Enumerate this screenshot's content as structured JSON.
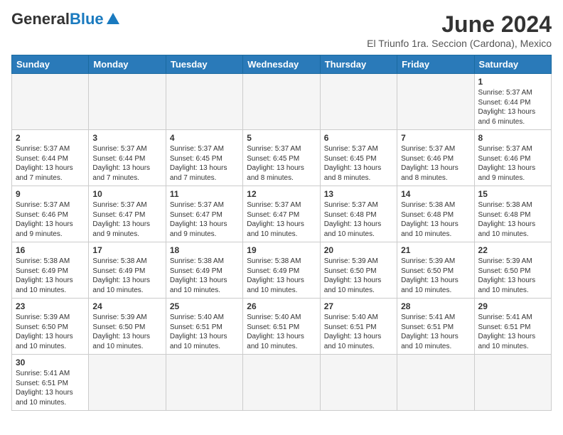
{
  "header": {
    "logo_general": "General",
    "logo_blue": "Blue",
    "title": "June 2024",
    "subtitle": "El Triunfo 1ra. Seccion (Cardona), Mexico"
  },
  "days_of_week": [
    "Sunday",
    "Monday",
    "Tuesday",
    "Wednesday",
    "Thursday",
    "Friday",
    "Saturday"
  ],
  "weeks": [
    [
      {
        "day": "",
        "info": ""
      },
      {
        "day": "",
        "info": ""
      },
      {
        "day": "",
        "info": ""
      },
      {
        "day": "",
        "info": ""
      },
      {
        "day": "",
        "info": ""
      },
      {
        "day": "",
        "info": ""
      },
      {
        "day": "1",
        "info": "Sunrise: 5:37 AM\nSunset: 6:44 PM\nDaylight: 13 hours and 6 minutes."
      }
    ],
    [
      {
        "day": "2",
        "info": "Sunrise: 5:37 AM\nSunset: 6:44 PM\nDaylight: 13 hours and 7 minutes."
      },
      {
        "day": "3",
        "info": "Sunrise: 5:37 AM\nSunset: 6:44 PM\nDaylight: 13 hours and 7 minutes."
      },
      {
        "day": "4",
        "info": "Sunrise: 5:37 AM\nSunset: 6:45 PM\nDaylight: 13 hours and 7 minutes."
      },
      {
        "day": "5",
        "info": "Sunrise: 5:37 AM\nSunset: 6:45 PM\nDaylight: 13 hours and 8 minutes."
      },
      {
        "day": "6",
        "info": "Sunrise: 5:37 AM\nSunset: 6:45 PM\nDaylight: 13 hours and 8 minutes."
      },
      {
        "day": "7",
        "info": "Sunrise: 5:37 AM\nSunset: 6:46 PM\nDaylight: 13 hours and 8 minutes."
      },
      {
        "day": "8",
        "info": "Sunrise: 5:37 AM\nSunset: 6:46 PM\nDaylight: 13 hours and 9 minutes."
      }
    ],
    [
      {
        "day": "9",
        "info": "Sunrise: 5:37 AM\nSunset: 6:46 PM\nDaylight: 13 hours and 9 minutes."
      },
      {
        "day": "10",
        "info": "Sunrise: 5:37 AM\nSunset: 6:47 PM\nDaylight: 13 hours and 9 minutes."
      },
      {
        "day": "11",
        "info": "Sunrise: 5:37 AM\nSunset: 6:47 PM\nDaylight: 13 hours and 9 minutes."
      },
      {
        "day": "12",
        "info": "Sunrise: 5:37 AM\nSunset: 6:47 PM\nDaylight: 13 hours and 10 minutes."
      },
      {
        "day": "13",
        "info": "Sunrise: 5:37 AM\nSunset: 6:48 PM\nDaylight: 13 hours and 10 minutes."
      },
      {
        "day": "14",
        "info": "Sunrise: 5:38 AM\nSunset: 6:48 PM\nDaylight: 13 hours and 10 minutes."
      },
      {
        "day": "15",
        "info": "Sunrise: 5:38 AM\nSunset: 6:48 PM\nDaylight: 13 hours and 10 minutes."
      }
    ],
    [
      {
        "day": "16",
        "info": "Sunrise: 5:38 AM\nSunset: 6:49 PM\nDaylight: 13 hours and 10 minutes."
      },
      {
        "day": "17",
        "info": "Sunrise: 5:38 AM\nSunset: 6:49 PM\nDaylight: 13 hours and 10 minutes."
      },
      {
        "day": "18",
        "info": "Sunrise: 5:38 AM\nSunset: 6:49 PM\nDaylight: 13 hours and 10 minutes."
      },
      {
        "day": "19",
        "info": "Sunrise: 5:38 AM\nSunset: 6:49 PM\nDaylight: 13 hours and 10 minutes."
      },
      {
        "day": "20",
        "info": "Sunrise: 5:39 AM\nSunset: 6:50 PM\nDaylight: 13 hours and 10 minutes."
      },
      {
        "day": "21",
        "info": "Sunrise: 5:39 AM\nSunset: 6:50 PM\nDaylight: 13 hours and 10 minutes."
      },
      {
        "day": "22",
        "info": "Sunrise: 5:39 AM\nSunset: 6:50 PM\nDaylight: 13 hours and 10 minutes."
      }
    ],
    [
      {
        "day": "23",
        "info": "Sunrise: 5:39 AM\nSunset: 6:50 PM\nDaylight: 13 hours and 10 minutes."
      },
      {
        "day": "24",
        "info": "Sunrise: 5:39 AM\nSunset: 6:50 PM\nDaylight: 13 hours and 10 minutes."
      },
      {
        "day": "25",
        "info": "Sunrise: 5:40 AM\nSunset: 6:51 PM\nDaylight: 13 hours and 10 minutes."
      },
      {
        "day": "26",
        "info": "Sunrise: 5:40 AM\nSunset: 6:51 PM\nDaylight: 13 hours and 10 minutes."
      },
      {
        "day": "27",
        "info": "Sunrise: 5:40 AM\nSunset: 6:51 PM\nDaylight: 13 hours and 10 minutes."
      },
      {
        "day": "28",
        "info": "Sunrise: 5:41 AM\nSunset: 6:51 PM\nDaylight: 13 hours and 10 minutes."
      },
      {
        "day": "29",
        "info": "Sunrise: 5:41 AM\nSunset: 6:51 PM\nDaylight: 13 hours and 10 minutes."
      }
    ],
    [
      {
        "day": "30",
        "info": "Sunrise: 5:41 AM\nSunset: 6:51 PM\nDaylight: 13 hours and 10 minutes."
      },
      {
        "day": "",
        "info": ""
      },
      {
        "day": "",
        "info": ""
      },
      {
        "day": "",
        "info": ""
      },
      {
        "day": "",
        "info": ""
      },
      {
        "day": "",
        "info": ""
      },
      {
        "day": "",
        "info": ""
      }
    ]
  ],
  "colors": {
    "header_bg": "#2a7ab9",
    "accent_blue": "#1a7abf"
  }
}
